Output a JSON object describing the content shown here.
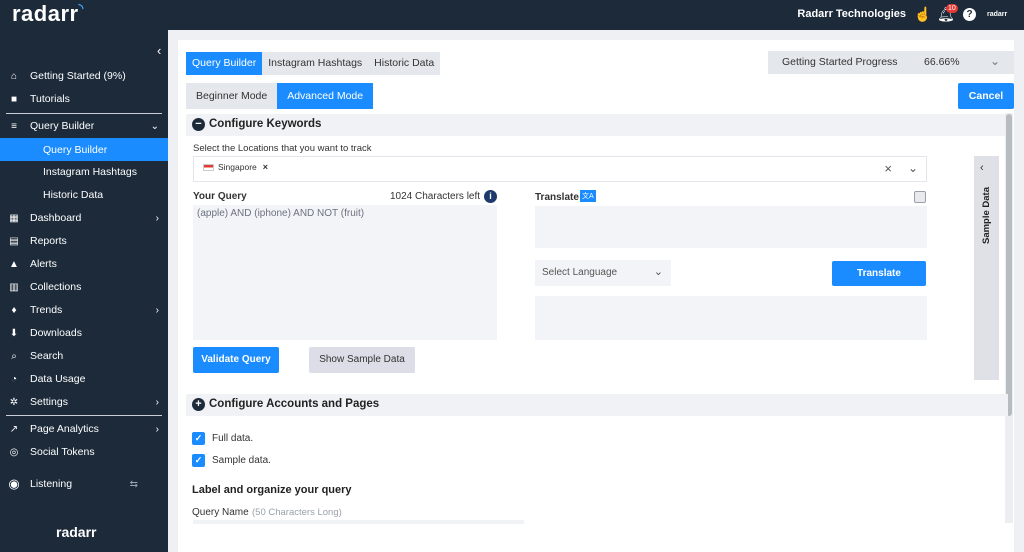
{
  "app": {
    "logo_text": "radarr",
    "company": "Radarr Technologies",
    "notifications_count": "10",
    "mini_logo": "radarr"
  },
  "sidebar": {
    "items": [
      {
        "label": "Getting Started (9%)",
        "icon": "home-icon",
        "glyph": "⌂"
      },
      {
        "label": "Tutorials",
        "icon": "video-icon",
        "glyph": "■"
      },
      {
        "label": "Query Builder",
        "icon": "layers-icon",
        "glyph": "≡"
      },
      {
        "label": "Query Builder"
      },
      {
        "label": "Instagram Hashtags"
      },
      {
        "label": "Historic Data"
      },
      {
        "label": "Dashboard",
        "icon": "grid-icon",
        "glyph": "▦"
      },
      {
        "label": "Reports",
        "icon": "document-icon",
        "glyph": "▤"
      },
      {
        "label": "Alerts",
        "icon": "warning-icon",
        "glyph": "▲"
      },
      {
        "label": "Collections",
        "icon": "collections-icon",
        "glyph": "▥"
      },
      {
        "label": "Trends",
        "icon": "flame-icon",
        "glyph": "♦"
      },
      {
        "label": "Downloads",
        "icon": "download-icon",
        "glyph": "⬇"
      },
      {
        "label": "Search",
        "icon": "search-icon",
        "glyph": "⌕"
      },
      {
        "label": "Data Usage",
        "icon": "gauge-icon",
        "glyph": "◔"
      },
      {
        "label": "Settings",
        "icon": "gear-icon",
        "glyph": "✲"
      },
      {
        "label": "Page Analytics",
        "icon": "analytics-icon",
        "glyph": "↗"
      },
      {
        "label": "Social Tokens",
        "icon": "token-icon",
        "glyph": "◎"
      },
      {
        "label": "Listening",
        "icon": "listening-icon",
        "glyph": "◉"
      }
    ],
    "bottom_logo": "radarr"
  },
  "tabs": [
    "Query Builder",
    "Instagram Hashtags",
    "Historic Data"
  ],
  "modes": [
    "Beginner Mode",
    "Advanced Mode"
  ],
  "progress": {
    "label": "Getting Started Progress",
    "value": "66.66%"
  },
  "cancel_label": "Cancel",
  "keywords": {
    "title": "Configure Keywords",
    "locations_label": "Select the Locations that you want to track",
    "location_chip": "Singapore",
    "query_label": "Your Query",
    "chars_left": "1024 Characters left",
    "query_value": "(apple) AND (iphone) AND NOT (fruit)",
    "translate_label": "Translate",
    "select_language": "Select Language",
    "translate_button": "Translate",
    "validate_button": "Validate Query",
    "sample_button": "Show Sample Data",
    "sample_panel_label": "Sample Data"
  },
  "accounts": {
    "title": "Configure Accounts and Pages",
    "full_data": "Full data.",
    "sample_data": "Sample data.",
    "organize_title": "Label and organize your query",
    "query_name_label": "Query Name",
    "query_name_placeholder": "(50 Characters Long)"
  },
  "colors": {
    "accent": "#1a8cff",
    "sidebar": "#1c2a3a"
  }
}
